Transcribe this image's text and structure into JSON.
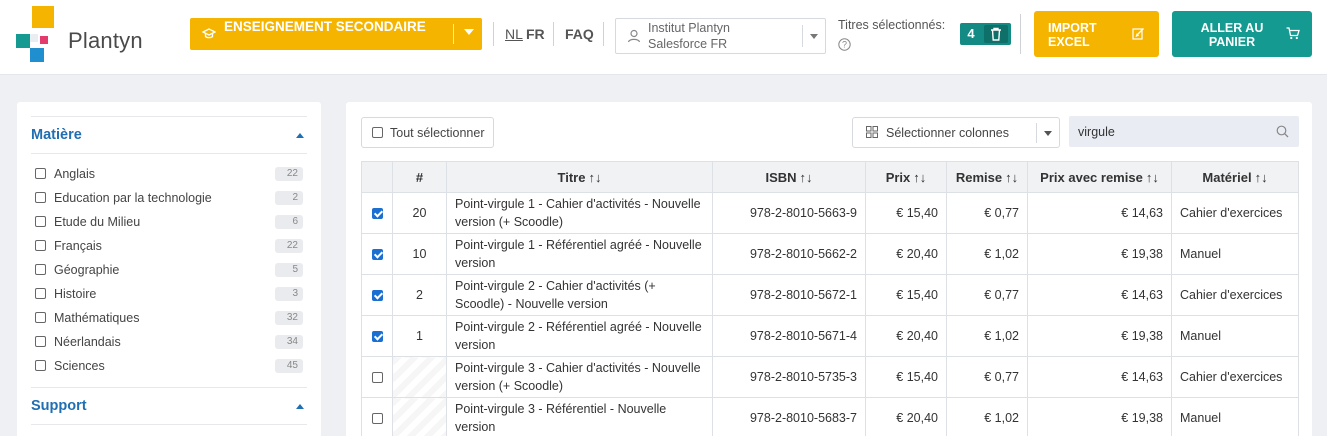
{
  "header": {
    "logo_text": "Plantyn",
    "segment": {
      "label": "ENSEIGNEMENT SECONDAIRE"
    },
    "lang_nl": "NL",
    "lang_fr": "FR",
    "faq": "FAQ",
    "institution": {
      "line1": "Institut Plantyn",
      "line2": "Salesforce FR"
    },
    "selected_label": "Titres sélectionnés:",
    "selected_count": "4",
    "import_button": "IMPORT EXCEL",
    "cart_button": "ALLER AU PANIER"
  },
  "sidebar": {
    "facet1": {
      "title": "Matière",
      "items": [
        {
          "label": "Anglais",
          "count": "22"
        },
        {
          "label": "Education par la technologie",
          "count": "2"
        },
        {
          "label": "Etude du Milieu",
          "count": "6"
        },
        {
          "label": "Français",
          "count": "22"
        },
        {
          "label": "Géographie",
          "count": "5"
        },
        {
          "label": "Histoire",
          "count": "3"
        },
        {
          "label": "Mathématiques",
          "count": "32"
        },
        {
          "label": "Néerlandais",
          "count": "34"
        },
        {
          "label": "Sciences",
          "count": "45"
        }
      ]
    },
    "facet2": {
      "title": "Support"
    }
  },
  "toolbar": {
    "select_all": "Tout sélectionner",
    "select_columns": "Sélectionner colonnes",
    "search_value": "virgule"
  },
  "table": {
    "columns": [
      "#",
      "Titre",
      "ISBN",
      "Prix",
      "Remise",
      "Prix avec remise",
      "Matériel"
    ],
    "rows": [
      {
        "checked": true,
        "num": "20",
        "title": "Point-virgule 1 - Cahier d'activités - Nouvelle version (+ Scoodle)",
        "isbn": "978-2-8010-5663-9",
        "price": "€ 15,40",
        "discount": "€ 0,77",
        "net": "€ 14,63",
        "material": "Cahier d'exercices"
      },
      {
        "checked": true,
        "num": "10",
        "title": "Point-virgule 1 - Référentiel agréé - Nouvelle version",
        "isbn": "978-2-8010-5662-2",
        "price": "€ 20,40",
        "discount": "€ 1,02",
        "net": "€ 19,38",
        "material": "Manuel"
      },
      {
        "checked": true,
        "num": "2",
        "title": "Point-virgule 2 - Cahier d'activités (+ Scoodle) - Nouvelle version",
        "isbn": "978-2-8010-5672-1",
        "price": "€ 15,40",
        "discount": "€ 0,77",
        "net": "€ 14,63",
        "material": "Cahier d'exercices"
      },
      {
        "checked": true,
        "num": "1",
        "title": "Point-virgule 2 - Référentiel agréé - Nouvelle version",
        "isbn": "978-2-8010-5671-4",
        "price": "€ 20,40",
        "discount": "€ 1,02",
        "net": "€ 19,38",
        "material": "Manuel"
      },
      {
        "checked": false,
        "num": "",
        "title": "Point-virgule 3 - Cahier d'activités - Nouvelle version (+ Scoodle)",
        "isbn": "978-2-8010-5735-3",
        "price": "€ 15,40",
        "discount": "€ 0,77",
        "net": "€ 14,63",
        "material": "Cahier d'exercices"
      },
      {
        "checked": false,
        "num": "",
        "title": "Point-virgule 3 - Référentiel - Nouvelle version",
        "isbn": "978-2-8010-5683-7",
        "price": "€ 20,40",
        "discount": "€ 1,02",
        "net": "€ 19,38",
        "material": "Manuel"
      }
    ]
  },
  "colors": {
    "accent_yellow": "#f5b400",
    "accent_teal": "#149a90",
    "link_blue": "#1f6fb2",
    "checkbox_blue": "#1a6fd0"
  }
}
